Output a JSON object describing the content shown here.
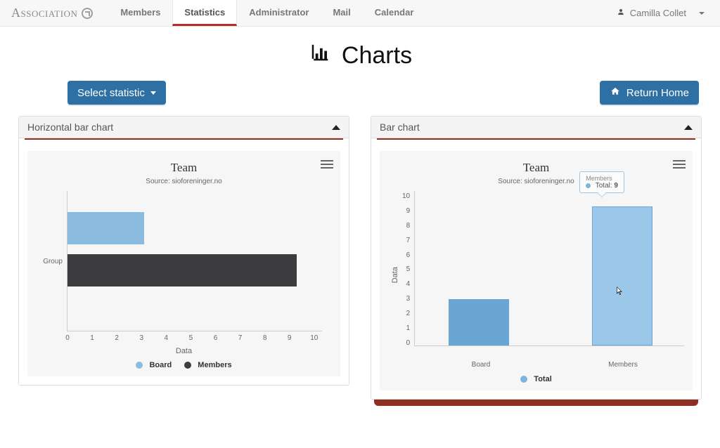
{
  "brand": "Association",
  "nav": {
    "items": [
      "Members",
      "Statistics",
      "Administrator",
      "Mail",
      "Calendar"
    ],
    "active": "Statistics"
  },
  "user": {
    "name": "Camilla Collet"
  },
  "page_title": "Charts",
  "buttons": {
    "select_statistic": "Select statistic",
    "return_home": "Return Home"
  },
  "panels": {
    "0": {
      "title": "Horizontal bar chart"
    },
    "1": {
      "title": "Bar chart"
    }
  },
  "hchart": {
    "title": "Team",
    "subtitle": "Source: sioforeninger.no",
    "ylabel": "Group",
    "xlabel": "Data",
    "ticks": [
      "0",
      "1",
      "2",
      "3",
      "4",
      "5",
      "6",
      "7",
      "8",
      "9",
      "10"
    ],
    "legend": {
      "board": "Board",
      "members": "Members"
    }
  },
  "vchart": {
    "title": "Team",
    "subtitle": "Source: sioforeninger.no",
    "ytitle": "Data",
    "yticks": [
      "10",
      "9",
      "8",
      "7",
      "6",
      "5",
      "4",
      "3",
      "2",
      "1",
      "0"
    ],
    "xcats": {
      "board": "Board",
      "members": "Members"
    },
    "legend": {
      "total": "Total"
    },
    "tooltip": {
      "header": "Members",
      "series": "Total:",
      "value": "9"
    }
  },
  "colors": {
    "board": "#8bbce0",
    "members_dark": "#3c3c3f",
    "total": "#7fb4dd",
    "accent": "#b52c27",
    "primary_btn": "#2e6fa4",
    "panel_shadow": "#8f2f23"
  },
  "chart_data": [
    {
      "type": "bar",
      "orientation": "horizontal",
      "title": "Team",
      "subtitle": "Source: sioforeninger.no",
      "xlabel": "Data",
      "ylabel": "Group",
      "xlim": [
        0,
        10
      ],
      "categories": [
        "Board",
        "Members"
      ],
      "series": [
        {
          "name": "Board",
          "values": [
            3,
            null
          ]
        },
        {
          "name": "Members",
          "values": [
            null,
            9
          ]
        }
      ],
      "values": [
        3,
        9
      ],
      "legend": [
        "Board",
        "Members"
      ]
    },
    {
      "type": "bar",
      "orientation": "vertical",
      "title": "Team",
      "subtitle": "Source: sioforeninger.no",
      "xlabel": "",
      "ylabel": "Data",
      "ylim": [
        0,
        10
      ],
      "categories": [
        "Board",
        "Members"
      ],
      "series": [
        {
          "name": "Total",
          "values": [
            3,
            9
          ]
        }
      ],
      "legend": [
        "Total"
      ],
      "highlight": {
        "category": "Members",
        "value": 9
      }
    }
  ]
}
